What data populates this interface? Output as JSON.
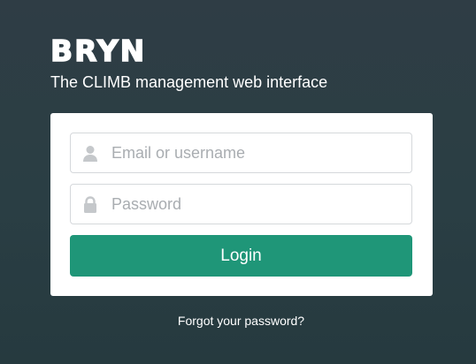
{
  "brand": {
    "logo_text": "BRYN",
    "tagline": "The CLIMB management web interface"
  },
  "login_form": {
    "email_field": {
      "placeholder": "Email or username",
      "value": "",
      "icon": "user-icon"
    },
    "password_field": {
      "placeholder": "Password",
      "value": "",
      "icon": "lock-icon"
    },
    "login_button_label": "Login"
  },
  "forgot_password_link": "Forgot your password?",
  "colors": {
    "background": "#2c3e44",
    "card": "#ffffff",
    "button": "#1f9678",
    "placeholder": "#a9adb1",
    "icon": "#c5c8cb"
  }
}
